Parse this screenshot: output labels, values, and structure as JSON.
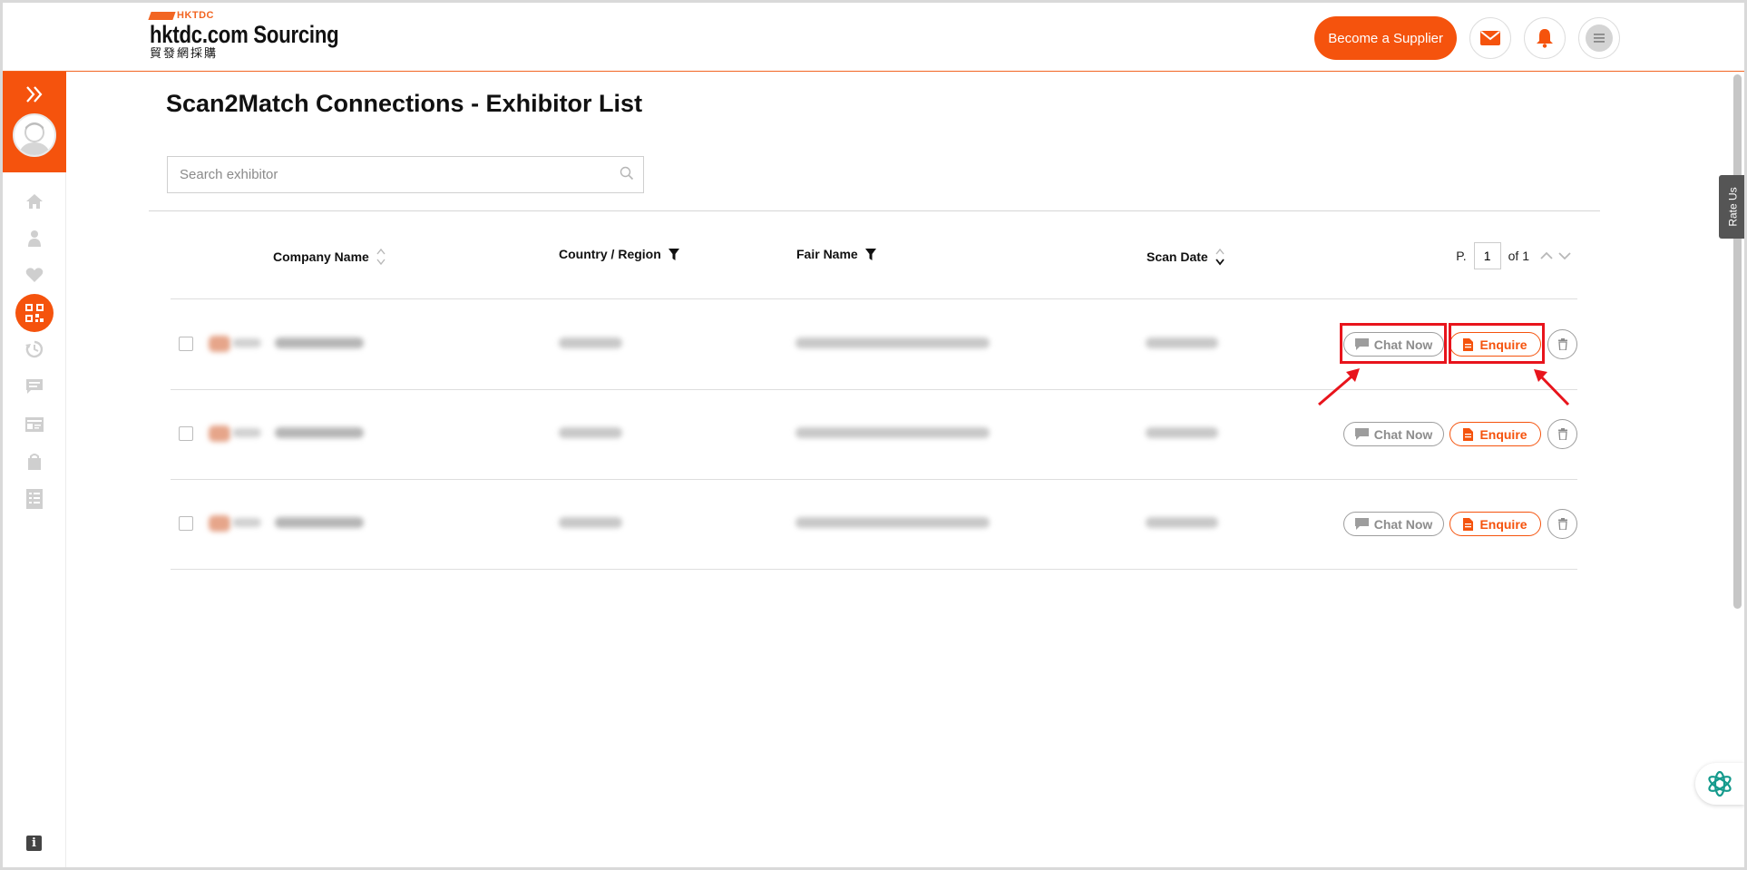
{
  "header": {
    "brand_mark": "HKTDC",
    "brand_name": "hktdc.com Sourcing",
    "brand_chinese": "貿發網採購",
    "become_supplier_label": "Become a Supplier",
    "icons": [
      "mail-icon",
      "bell-icon",
      "menu-icon"
    ]
  },
  "sidebar": {
    "expand_icon": "double-chevron-right-icon",
    "items": [
      "home-icon",
      "profile-icon",
      "favorites-icon",
      "scan2match-icon",
      "history-icon",
      "messages-icon",
      "card-icon",
      "bag-icon",
      "checklist-icon"
    ],
    "active_item": "scan2match-icon",
    "info_label": "i"
  },
  "page": {
    "title": "Scan2Match Connections - Exhibitor List",
    "search_placeholder": "Search exhibitor"
  },
  "table": {
    "columns": [
      "Company Name",
      "Country / Region",
      "Fair Name",
      "Scan Date"
    ],
    "pager": {
      "prefix": "P.",
      "current": "1",
      "of_label": "of 1"
    },
    "rows": [
      {
        "chat_label": "Chat Now",
        "enquire_label": "Enquire",
        "highlighted": true
      },
      {
        "chat_label": "Chat Now",
        "enquire_label": "Enquire",
        "highlighted": false
      },
      {
        "chat_label": "Chat Now",
        "enquire_label": "Enquire",
        "highlighted": false
      }
    ]
  },
  "rate_us": "Rate Us",
  "colors": {
    "accent": "#f5530d",
    "annotation": "#e8141c"
  }
}
